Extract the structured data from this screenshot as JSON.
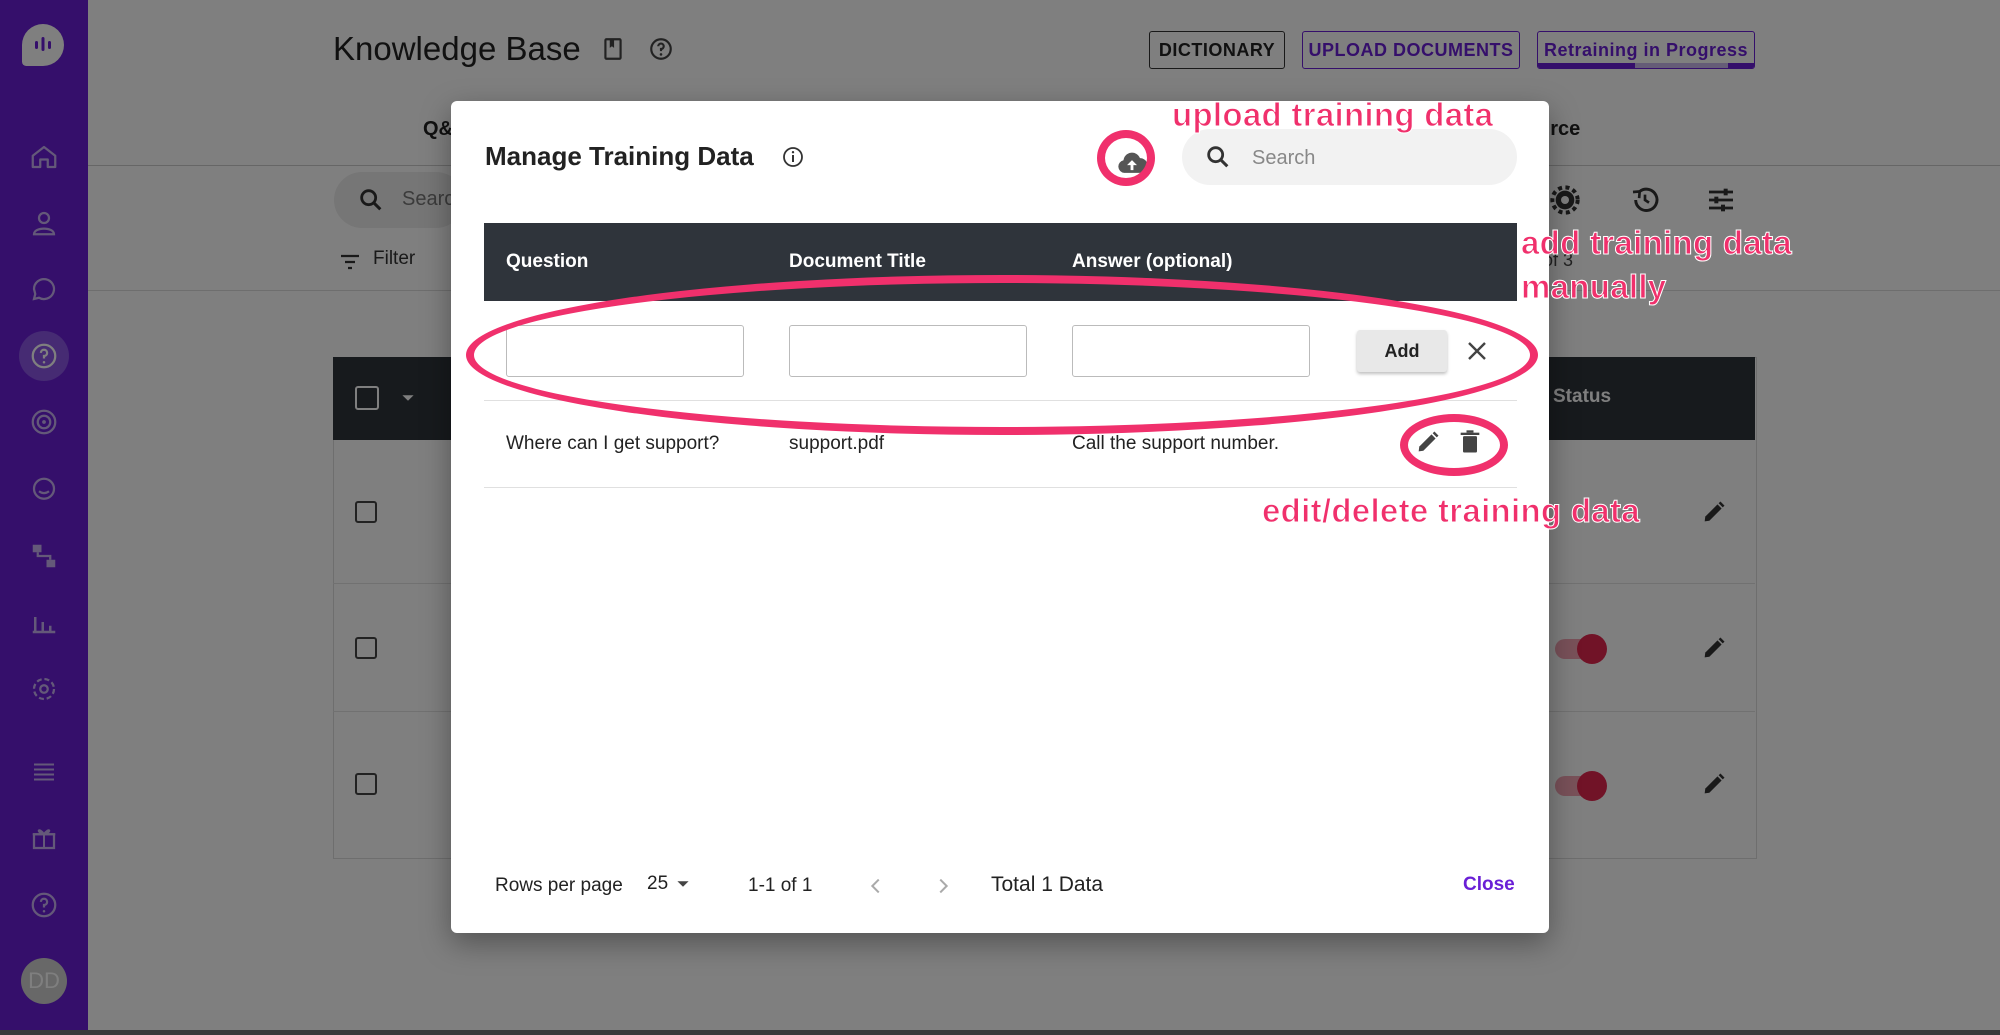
{
  "page": {
    "title": "Knowledge Base",
    "buttons": {
      "dictionary": "DICTIONARY",
      "upload": "UPLOAD DOCUMENTS",
      "retraining": "Retraining in Progress"
    },
    "tabs": {
      "qa_partial": "Q&",
      "source_partial": "urce"
    },
    "search_partial": "Searc",
    "filter": "Filter",
    "pager_partial": "3 of 3",
    "status_header": "Status",
    "avatar_initials": "DD"
  },
  "dialog": {
    "title": "Manage Training Data",
    "search_placeholder": "Search",
    "columns": {
      "question": "Question",
      "document_title": "Document Title",
      "answer": "Answer (optional)"
    },
    "add_label": "Add",
    "rows": [
      {
        "question": "Where can I get support?",
        "document_title": "support.pdf",
        "answer": "Call the support number."
      }
    ],
    "footer": {
      "rows_per_page_label": "Rows per page",
      "rows_per_page_value": "25",
      "range": "1-1 of 1",
      "total": "Total 1 Data",
      "close_label": "Close"
    }
  },
  "annotations": {
    "upload": "upload training data",
    "manual_line1": "add training data",
    "manual_line2": "manually",
    "edit_delete": "edit/delete training data"
  },
  "colors": {
    "sidebar": "#6a1fd6",
    "accent": "#6a1fd6",
    "annotation": "#f0306c",
    "table_header": "#2f343b",
    "toggle_on": "#e3264f"
  },
  "icons": {
    "sidebar": [
      "home-icon",
      "contacts-icon",
      "chat-icon",
      "knowledge-base-icon",
      "target-icon",
      "conversation-icon",
      "flow-icon",
      "analytics-icon",
      "settings-icon",
      "list-icon",
      "gift-icon",
      "help-icon"
    ],
    "dialog": [
      "info-icon",
      "cloud-upload-icon",
      "search-icon",
      "close-icon",
      "pencil-icon",
      "trash-icon",
      "chevron-left-icon",
      "chevron-right-icon",
      "caret-down-icon"
    ]
  }
}
